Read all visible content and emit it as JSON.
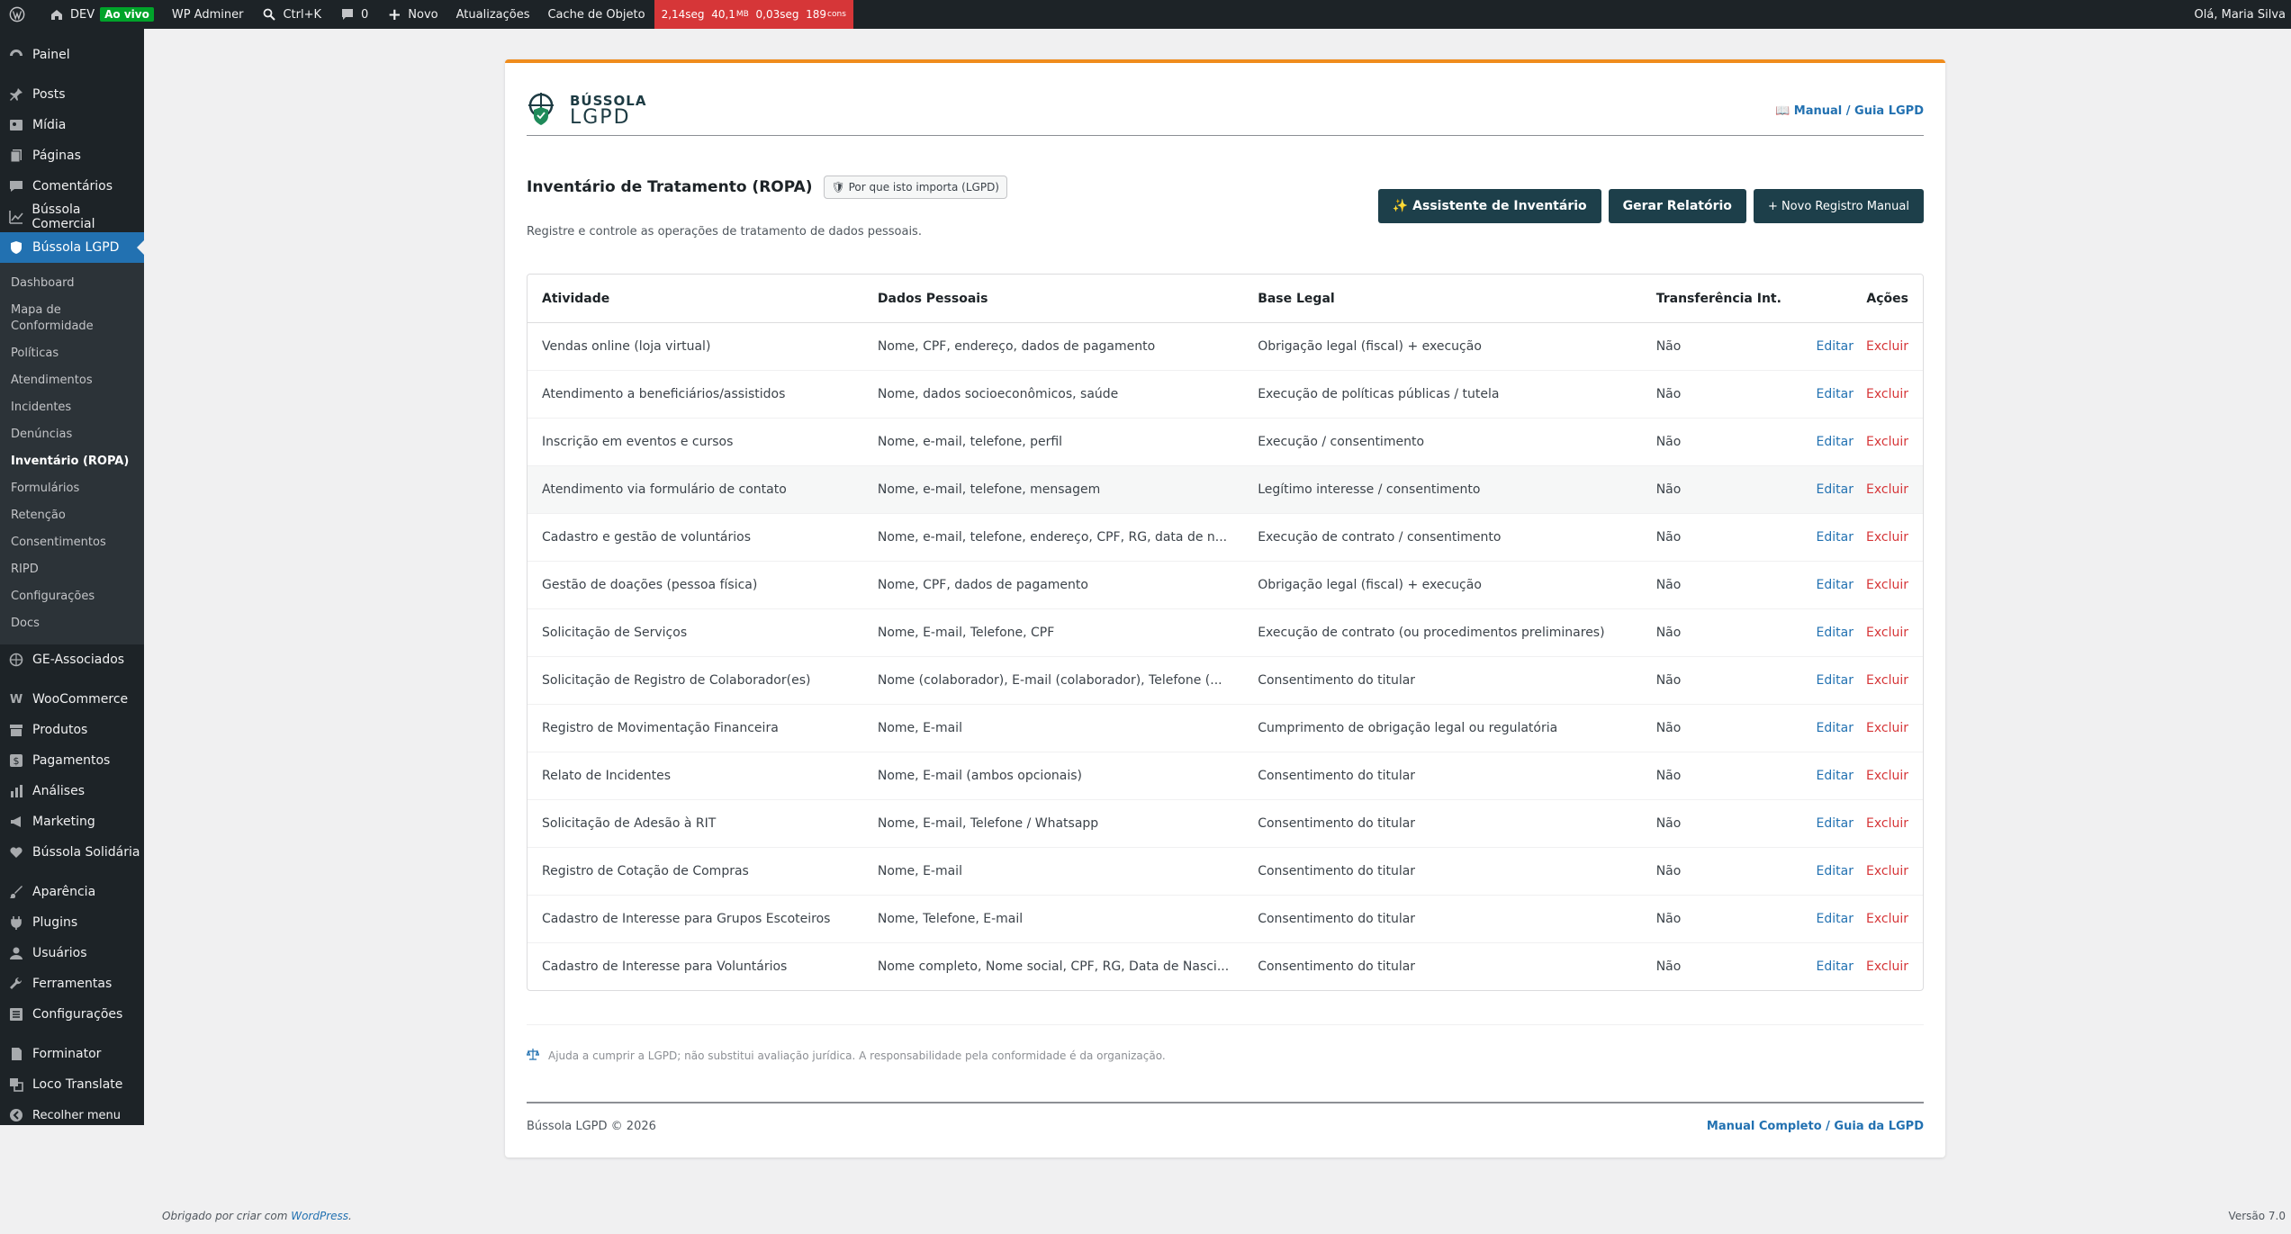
{
  "adminbar": {
    "site_name": "DEV",
    "live_badge": "Ao vivo",
    "wp_adminer": "WP Adminer",
    "search_shortcut": "Ctrl+K",
    "comments_count": "0",
    "new_label": "Novo",
    "updates_label": "Atualizações",
    "cache_label": "Cache de Objeto",
    "perf_time": "2,14seg",
    "perf_memory": "40,1",
    "perf_memory_unit": "MB",
    "perf_query_time": "0,03seg",
    "perf_queries": "189",
    "perf_queries_unit": "cons",
    "greeting": "Olá, Maria Silva"
  },
  "sidebar": {
    "top": [
      "Painel"
    ],
    "group1": [
      "Posts",
      "Mídia",
      "Páginas",
      "Comentários",
      "Bússola Comercial"
    ],
    "current": "Bússola LGPD",
    "submenu": [
      "Dashboard",
      "Mapa de Conformidade",
      "Políticas",
      "Atendimentos",
      "Incidentes",
      "Denúncias",
      "Inventário (ROPA)",
      "Formulários",
      "Retenção",
      "Consentimentos",
      "RIPD",
      "Configurações",
      "Docs"
    ],
    "submenu_current": "Inventário (ROPA)",
    "group2": [
      "GE-Associados"
    ],
    "group3": [
      "WooCommerce",
      "Produtos",
      "Pagamentos",
      "Análises",
      "Marketing",
      "Bússola Solidária"
    ],
    "group4": [
      "Aparência",
      "Plugins",
      "Usuários",
      "Ferramentas",
      "Configurações"
    ],
    "group5": [
      "Forminator",
      "Loco Translate",
      "Recolher menu"
    ]
  },
  "header": {
    "logo_line1": "BÚSSOLA",
    "logo_line2": "LGPD",
    "manual_link": "📖 Manual / Guia LGPD"
  },
  "page": {
    "title": "Inventário de Tratamento (ROPA)",
    "why_badge": "🛡 Por que isto importa (LGPD)",
    "subtitle": "Registre e controle as operações de tratamento de dados pessoais.",
    "btn_assistant": "✨ Assistente de Inventário",
    "btn_report": "Gerar Relatório",
    "btn_new": "+ Novo Registro Manual"
  },
  "table": {
    "headers": [
      "Atividade",
      "Dados Pessoais",
      "Base Legal",
      "Transferência Int.",
      "Ações"
    ],
    "edit_label": "Editar",
    "delete_label": "Excluir",
    "rows": [
      {
        "atividade": "Vendas online (loja virtual)",
        "dados": "Nome, CPF, endereço, dados de pagamento",
        "base": "Obrigação legal (fiscal) + execução",
        "transf": "Não"
      },
      {
        "atividade": "Atendimento a beneficiários/assistidos",
        "dados": "Nome, dados socioeconômicos, saúde",
        "base": "Execução de políticas públicas / tutela",
        "transf": "Não"
      },
      {
        "atividade": "Inscrição em eventos e cursos",
        "dados": "Nome, e-mail, telefone, perfil",
        "base": "Execução / consentimento",
        "transf": "Não"
      },
      {
        "atividade": "Atendimento via formulário de contato",
        "dados": "Nome, e-mail, telefone, mensagem",
        "base": "Legítimo interesse / consentimento",
        "transf": "Não"
      },
      {
        "atividade": "Cadastro e gestão de voluntários",
        "dados": "Nome, e-mail, telefone, endereço, CPF, RG, data de n...",
        "base": "Execução de contrato / consentimento",
        "transf": "Não"
      },
      {
        "atividade": "Gestão de doações (pessoa física)",
        "dados": "Nome, CPF, dados de pagamento",
        "base": "Obrigação legal (fiscal) + execução",
        "transf": "Não"
      },
      {
        "atividade": "Solicitação de Serviços",
        "dados": "Nome, E-mail, Telefone, CPF",
        "base": "Execução de contrato (ou procedimentos preliminares)",
        "transf": "Não"
      },
      {
        "atividade": "Solicitação de Registro de Colaborador(es)",
        "dados": "Nome (colaborador), E-mail (colaborador), Telefone (...",
        "base": "Consentimento do titular",
        "transf": "Não"
      },
      {
        "atividade": "Registro de Movimentação Financeira",
        "dados": "Nome, E-mail",
        "base": "Cumprimento de obrigação legal ou regulatória",
        "transf": "Não"
      },
      {
        "atividade": "Relato de Incidentes",
        "dados": "Nome, E-mail (ambos opcionais)",
        "base": "Consentimento do titular",
        "transf": "Não"
      },
      {
        "atividade": "Solicitação de Adesão à RIT",
        "dados": "Nome, E-mail, Telefone / Whatsapp",
        "base": "Consentimento do titular",
        "transf": "Não"
      },
      {
        "atividade": "Registro de Cotação de Compras",
        "dados": "Nome, E-mail",
        "base": "Consentimento do titular",
        "transf": "Não"
      },
      {
        "atividade": "Cadastro de Interesse para Grupos Escoteiros",
        "dados": "Nome, Telefone, E-mail",
        "base": "Consentimento do titular",
        "transf": "Não"
      },
      {
        "atividade": "Cadastro de Interesse para Voluntários",
        "dados": "Nome completo, Nome social, CPF, RG, Data de Nasci...",
        "base": "Consentimento do titular",
        "transf": "Não"
      }
    ]
  },
  "disclaimer": "Ajuda a cumprir a LGPD; não substitui avaliação jurídica. A responsabilidade pela conformidade é da organização.",
  "footer": {
    "copyright": "Bússola LGPD © 2026",
    "manual_link": "Manual Completo / Guia da LGPD"
  },
  "wp_footer": {
    "thanks_prefix": "Obrigado por criar com",
    "wordpress_link": "WordPress",
    "thanks_suffix": ".",
    "version": "Versão 7.0"
  },
  "colors": {
    "accent_orange": "#f08c1c",
    "dark_button": "#1d3f4a",
    "link_blue": "#2271b1",
    "delete_red": "#d63638",
    "menu_current": "#2271b1"
  }
}
